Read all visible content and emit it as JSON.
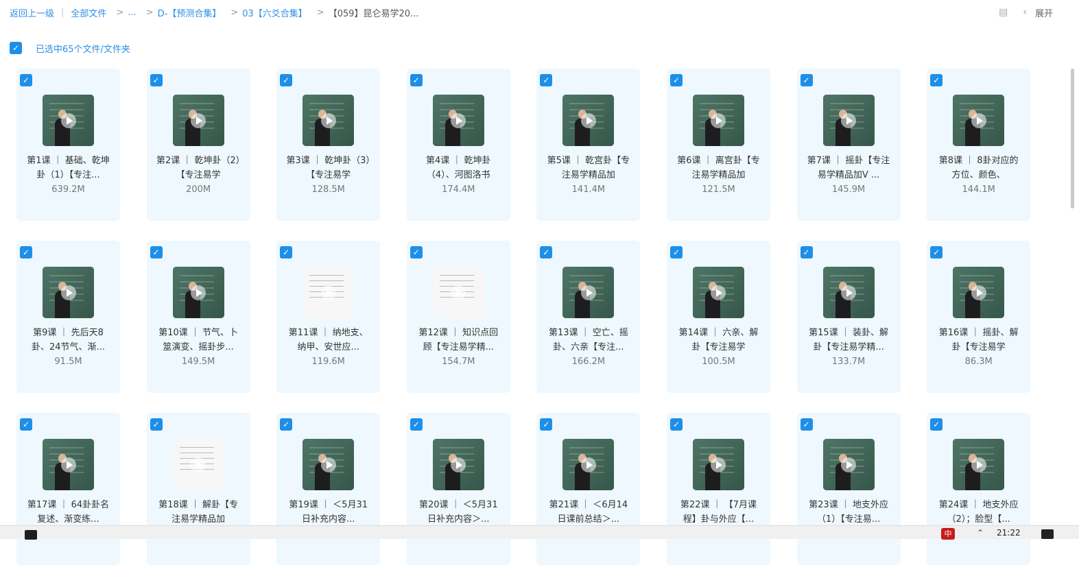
{
  "breadcrumb": {
    "back": "返回上一级",
    "all_files": "全部文件",
    "ellipsis": "...",
    "level1": "D-【预测合集】",
    "level2": "03【六爻合集】",
    "current": "【059】昆仑易学20..."
  },
  "header": {
    "expand_label": "展开"
  },
  "selection": {
    "label": "已选中65个文件/文件夹"
  },
  "files": [
    {
      "name": "第1课 ｜ 基础、乾坤卦（1）【专注...",
      "size": "639.2M",
      "thumb": "dark"
    },
    {
      "name": "第2课 ｜ 乾坤卦（2）【专注易学",
      "size": "200M",
      "thumb": "dark"
    },
    {
      "name": "第3课 ｜ 乾坤卦（3）【专注易学",
      "size": "128.5M",
      "thumb": "dark"
    },
    {
      "name": "第4课 ｜ 乾坤卦（4）、河图洛书",
      "size": "174.4M",
      "thumb": "dark"
    },
    {
      "name": "第5课 ｜ 乾宫卦【专注易学精品加",
      "size": "141.4M",
      "thumb": "dark"
    },
    {
      "name": "第6课 ｜ 离宫卦【专注易学精品加",
      "size": "121.5M",
      "thumb": "dark"
    },
    {
      "name": "第7课 ｜ 摇卦【专注易学精品加V ...",
      "size": "145.9M",
      "thumb": "dark"
    },
    {
      "name": "第8课 ｜ 8卦对应的方位、颜色、",
      "size": "144.1M",
      "thumb": "dark"
    },
    {
      "name": "第9课 ｜ 先后天8卦、24节气、渐...",
      "size": "91.5M",
      "thumb": "dark"
    },
    {
      "name": "第10课 ｜ 节气、卜筮演变、摇卦步...",
      "size": "149.5M",
      "thumb": "dark"
    },
    {
      "name": "第11课 ｜ 纳地支、纳甲、安世应...",
      "size": "119.6M",
      "thumb": "white"
    },
    {
      "name": "第12课 ｜ 知识点回顾【专注易学精...",
      "size": "154.7M",
      "thumb": "white"
    },
    {
      "name": "第13课 ｜ 空亡、摇卦、六亲【专注...",
      "size": "166.2M",
      "thumb": "dark"
    },
    {
      "name": "第14课 ｜ 六亲、解卦【专注易学",
      "size": "100.5M",
      "thumb": "dark"
    },
    {
      "name": "第15课 ｜ 装卦、解卦【专注易学精...",
      "size": "133.7M",
      "thumb": "dark"
    },
    {
      "name": "第16课 ｜ 摇卦、解卦【专注易学",
      "size": "86.3M",
      "thumb": "dark"
    },
    {
      "name": "第17课 ｜ 64卦卦名复述、渐变练...",
      "size": "",
      "thumb": "dark"
    },
    {
      "name": "第18课 ｜ 解卦【专注易学精品加",
      "size": "",
      "thumb": "white"
    },
    {
      "name": "第19课 ｜ ＜5月31日补充内容...",
      "size": "",
      "thumb": "dark"
    },
    {
      "name": "第20课 ｜ ＜5月31日补充内容＞...",
      "size": "",
      "thumb": "dark"
    },
    {
      "name": "第21课 ｜ ＜6月14日课前总结＞...",
      "size": "",
      "thumb": "dark"
    },
    {
      "name": "第22课 ｜ 【7月课程】卦与外应【...",
      "size": "",
      "thumb": "dark"
    },
    {
      "name": "第23课 ｜ 地支外应（1）【专注易...",
      "size": "",
      "thumb": "dark"
    },
    {
      "name": "第24课 ｜ 地支外应（2）；脸型【...",
      "size": "",
      "thumb": "dark"
    }
  ],
  "taskbar": {
    "ime": "中",
    "time": "21:22"
  },
  "icons": {
    "check": "✓",
    "chevron_left": "‹",
    "panel": "monitor-icon"
  },
  "colors": {
    "accent": "#1e8fe8",
    "card_bg": "#eef8fe"
  }
}
